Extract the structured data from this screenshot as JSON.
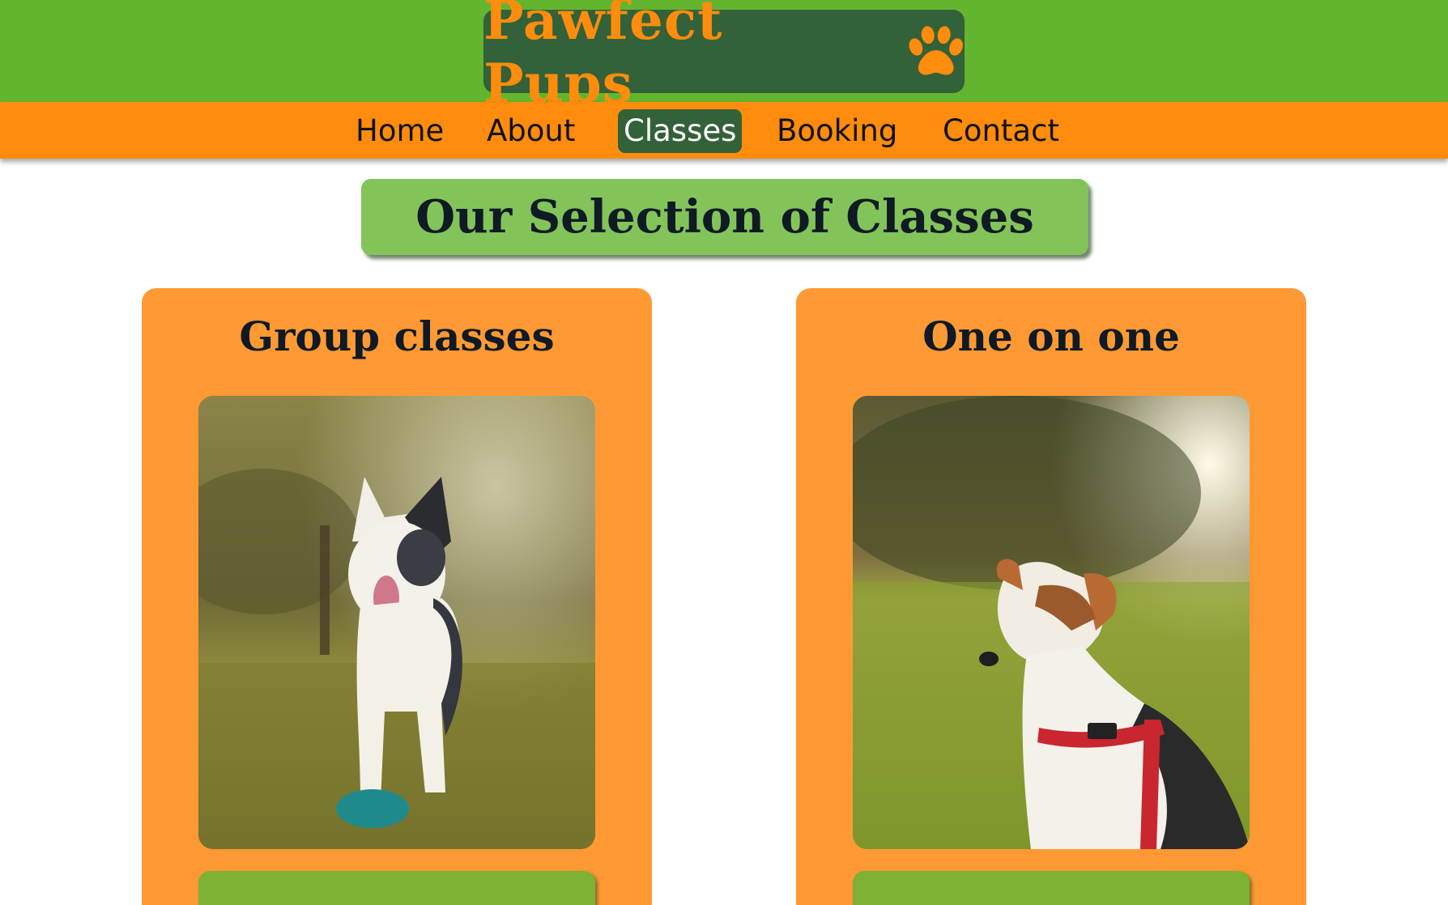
{
  "header": {
    "brand": "Pawfect Pups",
    "brand_icon": "paw-icon",
    "colors": {
      "top_bar": "#63b52f",
      "brand_box": "#336139",
      "brand_text": "#ff8c0d"
    }
  },
  "nav": {
    "items": [
      {
        "label": "Home"
      },
      {
        "label": "About"
      },
      {
        "label": "Classes",
        "active": true
      },
      {
        "label": "Booking"
      },
      {
        "label": "Contact"
      }
    ],
    "colors": {
      "bar": "#ff8c0d",
      "active_bg": "#336139"
    }
  },
  "main": {
    "heading": "Our Selection of Classes",
    "cards": [
      {
        "title": "Group classes",
        "image": "photo of a black and white border collie with a ball on grass"
      },
      {
        "title": "One on one",
        "image": "photo of a jack russell terrier in a red harness on grass"
      }
    ],
    "colors": {
      "heading_bg": "#82c45a",
      "card_bg": "#ff9933",
      "card_button": "#7db235"
    }
  }
}
